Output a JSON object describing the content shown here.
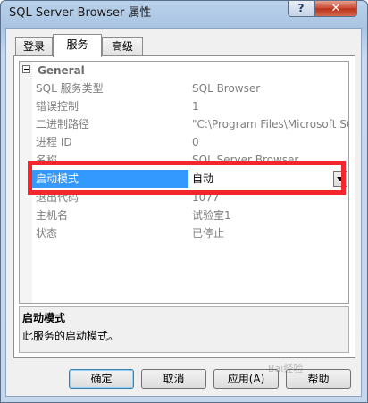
{
  "window": {
    "title": "SQL Server Browser 属性",
    "help_label": "?",
    "close_label": "✕"
  },
  "tabs": [
    {
      "label": "登录"
    },
    {
      "label": "服务"
    },
    {
      "label": "高级"
    }
  ],
  "grid": {
    "category": "General",
    "rows": [
      {
        "label": "SQL 服务类型",
        "value": "SQL Browser"
      },
      {
        "label": "错误控制",
        "value": "1"
      },
      {
        "label": "二进制路径",
        "value": "\"C:\\Program Files\\Microsoft SQL"
      },
      {
        "label": "进程 ID",
        "value": "0"
      },
      {
        "label": "名称",
        "value": "SQL Server Browser"
      }
    ],
    "selected": {
      "label": "启动模式",
      "value": "自动"
    },
    "rows_after": [
      {
        "label": "退出代码",
        "value": "1077"
      },
      {
        "label": "主机名",
        "value": "试验室1"
      },
      {
        "label": "状态",
        "value": "已停止"
      }
    ]
  },
  "description": {
    "title": "启动模式",
    "text": "此服务的启动模式。"
  },
  "buttons": {
    "ok": "确定",
    "cancel": "取消",
    "apply": "应用(A)",
    "help": "帮助"
  },
  "watermark": "Bai经验"
}
